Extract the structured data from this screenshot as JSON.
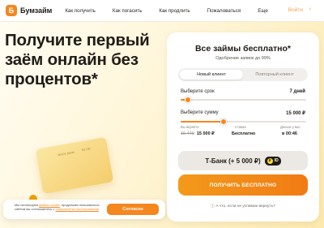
{
  "header": {
    "logo_text": "Бумзайм",
    "logo_glyph": "Б",
    "nav": [
      "Как получить",
      "Как погасить",
      "Как продлить",
      "Пожаловаться",
      "Еще"
    ],
    "login": "Войти",
    "login_chevron": "›"
  },
  "hero": {
    "title": "Получите первый заём онлайн без процентов*",
    "card_label_left": "MOCK BANK",
    "card_label_right": "00 / 00"
  },
  "calculator": {
    "title": "Все займы бесплатно*",
    "subtitle": "Одобрение заявок до 99%",
    "tabs": {
      "new": "Новый клиент",
      "repeat": "Повторный клиент"
    },
    "term": {
      "label": "Выберите срок",
      "value": "7 дней",
      "level": 0.06
    },
    "amount": {
      "label": "Выберите сумму",
      "value": "15 000 ₽",
      "level": 0.34
    },
    "info": {
      "payback_label": "Вы вернёте",
      "payback_old": "15 440",
      "payback_value": "15 000 ₽",
      "rate_label": "Ставка",
      "rate_value": "Бесплатно",
      "money_label": "Деньги у вас",
      "money_value": "в 00:46"
    },
    "bank_button": {
      "label": "Т-Банк (+ 5 000 ₽)",
      "badge_ruble": "₽",
      "badge_id": "ID"
    },
    "cta": "ПОЛУЧИТЬ БЕСПЛАТНО",
    "question": "ⓘ А что, если не успеваю вернуть?"
  },
  "cookie": {
    "text_1": "Мы используем ",
    "link_1": "файлы cookie",
    "text_2": ", продолжая пользоваться сайтом вы соглашаетесь с ",
    "link_2": "политикой их использования",
    "button": "Согласен"
  },
  "colors": {
    "accent": "#f5871f",
    "panel": "#ffffff",
    "background": "#fff6d9"
  }
}
